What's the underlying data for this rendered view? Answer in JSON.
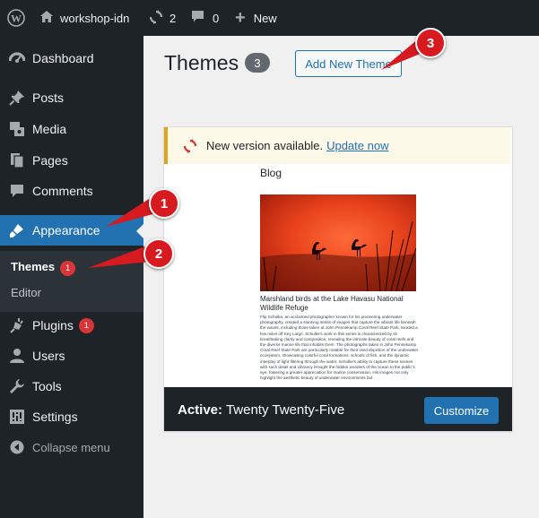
{
  "adminbar": {
    "site_name": "workshop-idn",
    "updates_count": "2",
    "comments_count": "0",
    "new_label": "New"
  },
  "sidebar": {
    "items": [
      {
        "label": "Dashboard",
        "icon": "dashboard-icon"
      },
      {
        "label": "Posts",
        "icon": "pin-icon"
      },
      {
        "label": "Media",
        "icon": "media-icon"
      },
      {
        "label": "Pages",
        "icon": "pages-icon"
      },
      {
        "label": "Comments",
        "icon": "comments-icon"
      },
      {
        "label": "Appearance",
        "icon": "brush-icon"
      },
      {
        "label": "Plugins",
        "icon": "plugin-icon",
        "badge": "1"
      },
      {
        "label": "Users",
        "icon": "users-icon"
      },
      {
        "label": "Tools",
        "icon": "wrench-icon"
      },
      {
        "label": "Settings",
        "icon": "settings-icon"
      },
      {
        "label": "Collapse menu",
        "icon": "collapse-icon"
      }
    ],
    "submenu": [
      {
        "label": "Themes",
        "badge": "1"
      },
      {
        "label": "Editor"
      }
    ]
  },
  "page": {
    "title": "Themes",
    "count": "3",
    "add_new_label": "Add New Theme"
  },
  "theme_card": {
    "notice_text": "New version available.",
    "notice_link": "Update now",
    "preview": {
      "blog_label": "Blog",
      "post_title": "Marshland birds at the Lake Havasu National Wildlife Refuge",
      "post_text": "Flip Schulke, an acclaimed photographer known for his pioneering underwater photography, created a stunning series of images that capture the vibrant life beneath the waves, including those taken at John Pennekamp Coral Reef State Park, located a few miles off Key Largo. Schulke's work in this series is characterized by its breathtaking clarity and composition, revealing the intricate beauty of coral reefs and the diverse marine life that inhabits them. The photographs taken in John Pennekamp Coral Reef State Park are particularly notable for their vivid depiction of the underwater ecosystem, showcasing colorful coral formations, schools of fish, and the dynamic interplay of light filtering through the water. Schulke's ability to capture these scenes with such detail and vibrancy brought the hidden wonders of the ocean to the public's eye, fostering a greater appreciation for marine conservation. His images not only highlight the aesthetic beauty of underwater environments but"
    },
    "active_prefix": "Active:",
    "theme_name": "Twenty Twenty-Five",
    "customize_label": "Customize"
  },
  "callouts": [
    "1",
    "2",
    "3"
  ],
  "colors": {
    "adminbar_bg": "#1d2327",
    "accent": "#2271b1",
    "badge_red": "#d63638",
    "callout_red": "#d71920",
    "notice_border": "#dba617"
  }
}
